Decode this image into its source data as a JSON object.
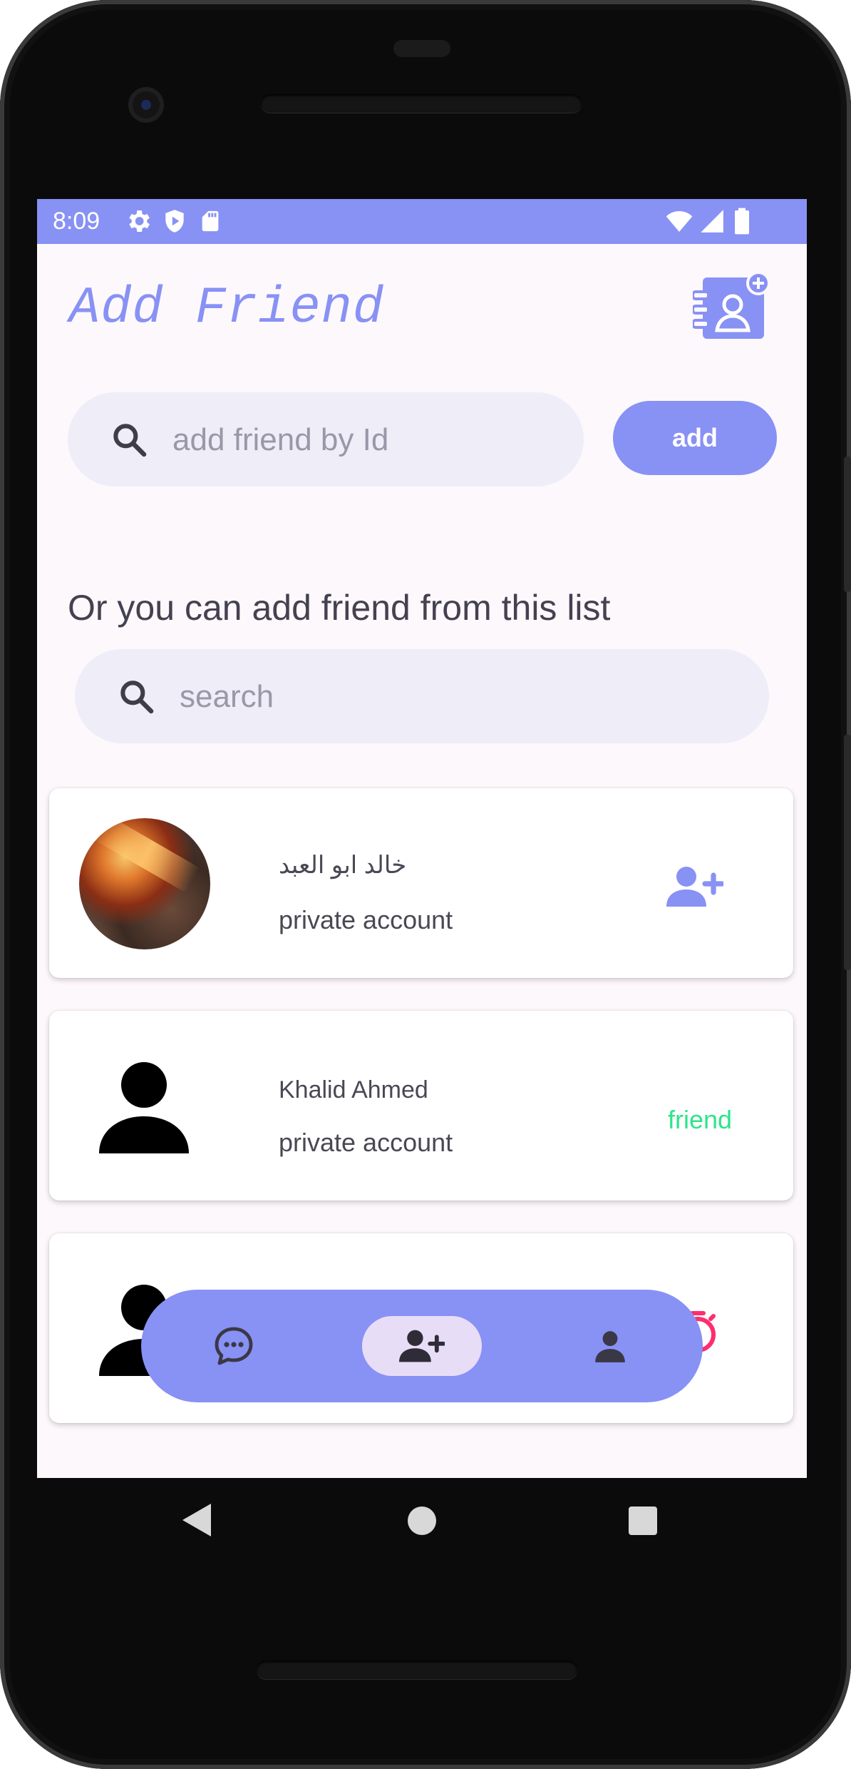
{
  "status_bar": {
    "time": "8:09"
  },
  "header": {
    "title": "Add Friend"
  },
  "add_by_id": {
    "placeholder": "add friend by Id",
    "button_label": "add"
  },
  "list_section": {
    "subtitle": "Or you can add friend from this list",
    "search_placeholder": "search"
  },
  "users": [
    {
      "name": "خالد ابو العبد",
      "account": "private account",
      "action": "add-person"
    },
    {
      "name": "Khalid Ahmed",
      "account": "private account",
      "action": "friend",
      "action_label": "friend"
    },
    {
      "name": "",
      "account": "",
      "action": "pending"
    }
  ],
  "bottom_nav": {
    "items": [
      "chats",
      "add-friend",
      "profile"
    ],
    "active": "add-friend"
  },
  "colors": {
    "accent": "#8891f4",
    "friend": "#2ee48a",
    "pending": "#ff2d6f",
    "background": "#fdf8fc"
  }
}
